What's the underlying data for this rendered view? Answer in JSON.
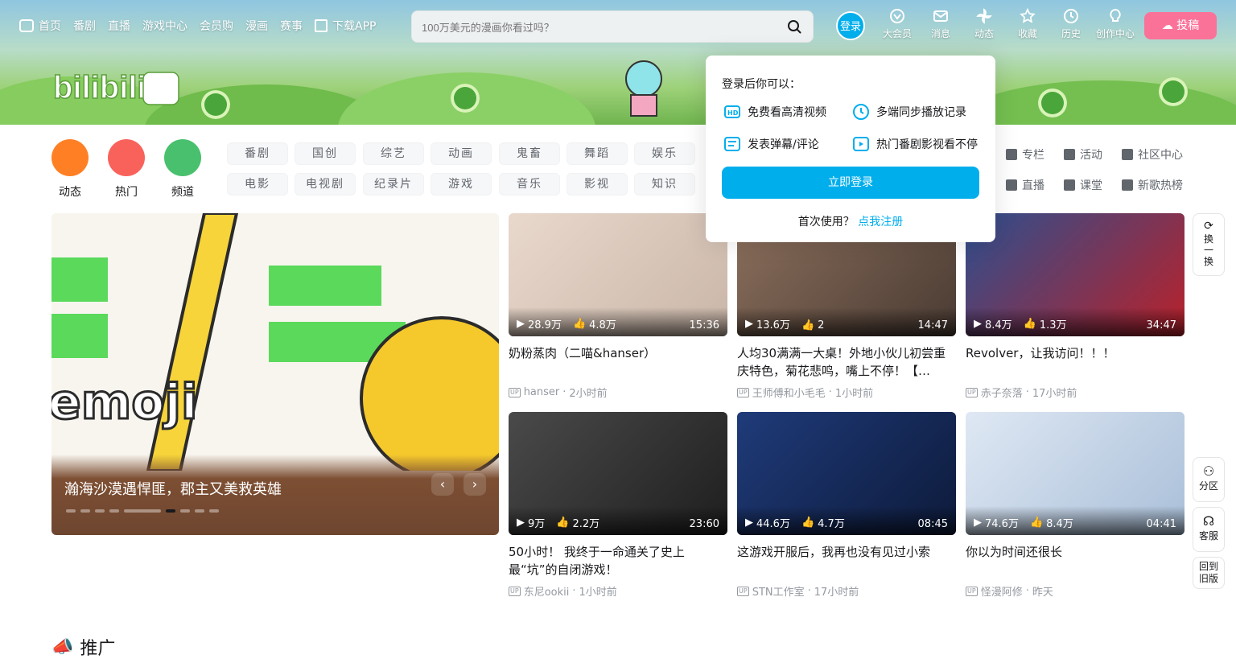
{
  "topnav": {
    "items": [
      "首页",
      "番剧",
      "直播",
      "游戏中心",
      "会员购",
      "漫画",
      "赛事",
      "下载APP"
    ]
  },
  "search": {
    "placeholder": "100万美元的漫画你看过吗？"
  },
  "header_right": {
    "login": "登录",
    "items": [
      "大会员",
      "消息",
      "动态",
      "收藏",
      "历史",
      "创作中心"
    ],
    "upload": "投稿"
  },
  "channels": {
    "big": [
      "动态",
      "热门",
      "频道"
    ],
    "row1": [
      "番剧",
      "国创",
      "综艺",
      "动画",
      "鬼畜",
      "舞蹈",
      "娱乐"
    ],
    "row2": [
      "电影",
      "电视剧",
      "纪录片",
      "游戏",
      "音乐",
      "影视",
      "知识"
    ],
    "extra_row1": [
      "专栏",
      "活动",
      "社区中心"
    ],
    "extra_row2": [
      "直播",
      "课堂",
      "新歌热榜"
    ]
  },
  "carousel": {
    "title": "瀚海沙漠遇悍匪，郡主又美救英雄"
  },
  "videos": [
    {
      "views": "28.9万",
      "likes": "4.8万",
      "duration": "15:36",
      "title": "奶粉蒸肉（二喵&hanser）",
      "uploader": "hanser",
      "time": "2小时前"
    },
    {
      "views": "13.6万",
      "likes": "2",
      "duration": "14:47",
      "title": "人均30满满一大桌！外地小伙儿初尝重庆特色，菊花悲鸣，嘴上不停！【…",
      "uploader": "王师傅和小毛毛",
      "time": "1小时前"
    },
    {
      "views": "8.4万",
      "likes": "1.3万",
      "duration": "34:47",
      "title": "Revolver，让我访问！！！",
      "uploader": "赤子奈落",
      "time": "17小时前"
    },
    {
      "views": "9万",
      "likes": "2.2万",
      "duration": "23:60",
      "title": "50小时！ 我终于一命通关了史上最“坑”的自闭游戏！",
      "uploader": "东尼ookii",
      "time": "1小时前"
    },
    {
      "views": "44.6万",
      "likes": "4.7万",
      "duration": "08:45",
      "title": "这游戏开服后，我再也没有见过小索",
      "uploader": "STN工作室",
      "time": "17小时前"
    },
    {
      "views": "74.6万",
      "likes": "8.4万",
      "duration": "04:41",
      "title": "你以为时间还很长",
      "uploader": "怪漫阿修",
      "time": "昨天"
    }
  ],
  "popup": {
    "title": "登录后你可以：",
    "features": [
      "免费看高清视频",
      "多端同步播放记录",
      "发表弹幕/评论",
      "热门番剧影视看不停"
    ],
    "login_button": "立即登录",
    "register_prompt": "首次使用？",
    "register_link": "点我注册"
  },
  "side": {
    "refresh": "换一换",
    "category": "分区",
    "service": "客服",
    "old": "回到旧版"
  },
  "promo": {
    "title": "推广"
  }
}
